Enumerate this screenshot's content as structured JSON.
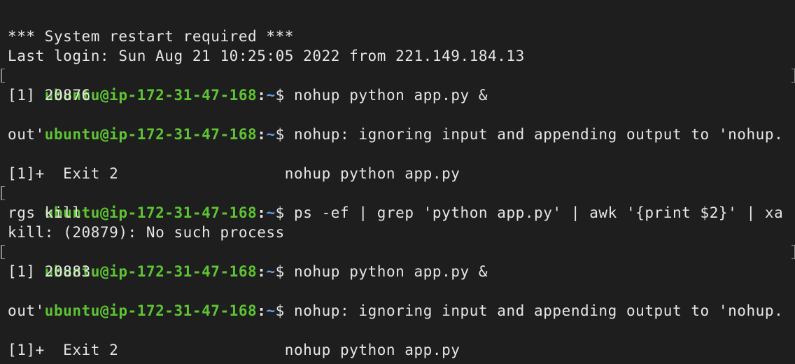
{
  "terminal": {
    "prompt": {
      "user_host": "ubuntu@ip-172-31-47-168",
      "separator": ":",
      "path": "~",
      "symbol": "$ "
    },
    "lines": [
      {
        "type": "text",
        "text": "*** System restart required ***"
      },
      {
        "type": "text",
        "text": "Last login: Sun Aug 21 10:25:05 2022 from 221.149.184.13"
      },
      {
        "type": "prompt",
        "bracketed": true,
        "command": "nohup python app.py &"
      },
      {
        "type": "text",
        "text": "[1] 20876"
      },
      {
        "type": "prompt",
        "bracketed": false,
        "command": "nohup: ignoring input and appending output to 'nohup."
      },
      {
        "type": "text",
        "text": "out'"
      },
      {
        "type": "text",
        "text": ""
      },
      {
        "type": "text",
        "text": "[1]+  Exit 2                  nohup python app.py"
      },
      {
        "type": "prompt",
        "bracketed": true,
        "command": "ps -ef | grep 'python app.py' | awk '{print $2}' | xa"
      },
      {
        "type": "text",
        "text": "rgs kill"
      },
      {
        "type": "text",
        "text": "kill: (20879): No such process"
      },
      {
        "type": "prompt",
        "bracketed": true,
        "command": "nohup python app.py &"
      },
      {
        "type": "text",
        "text": "[1] 20883"
      },
      {
        "type": "prompt",
        "bracketed": false,
        "command": "nohup: ignoring input and appending output to 'nohup."
      },
      {
        "type": "text",
        "text": "out'"
      },
      {
        "type": "text",
        "text": ""
      },
      {
        "type": "text",
        "text": "[1]+  Exit 2                  nohup python app.py"
      }
    ]
  },
  "colors": {
    "background": "#1e1e1e",
    "foreground": "#e6e6e6",
    "user_host": "#5ec433",
    "path": "#5fa0e8"
  }
}
